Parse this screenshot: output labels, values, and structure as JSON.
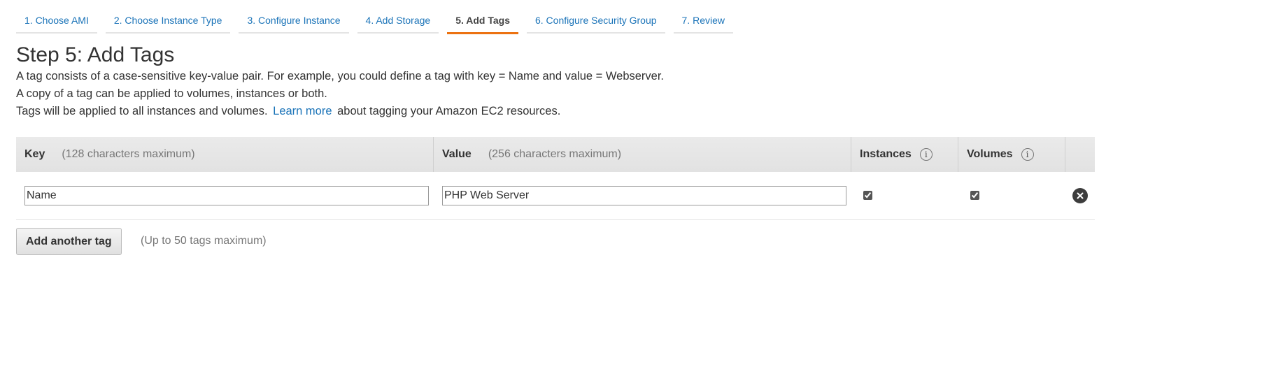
{
  "wizard": {
    "steps": [
      {
        "label": "1. Choose AMI"
      },
      {
        "label": "2. Choose Instance Type"
      },
      {
        "label": "3. Configure Instance"
      },
      {
        "label": "4. Add Storage"
      },
      {
        "label": "5. Add Tags"
      },
      {
        "label": "6. Configure Security Group"
      },
      {
        "label": "7. Review"
      }
    ],
    "active_step": "5. Add Tags"
  },
  "page": {
    "title": "Step 5: Add Tags",
    "description": {
      "line1": "A tag consists of a case-sensitive key-value pair. For example, you could define a tag with key = Name and value = Webserver.",
      "line2": "A copy of a tag can be applied to volumes, instances or both.",
      "line3_before": "Tags will be applied to all instances and volumes.",
      "learn_more": "Learn more",
      "line3_after": "about tagging your Amazon EC2 resources."
    }
  },
  "table": {
    "headers": {
      "key_label": "Key",
      "key_hint": "(128 characters maximum)",
      "value_label": "Value",
      "value_hint": "(256 characters maximum)",
      "instances_label": "Instances",
      "volumes_label": "Volumes",
      "info_glyph": "i"
    },
    "rows": [
      {
        "key": "Name",
        "value": "PHP Web Server",
        "instances": true,
        "volumes": true,
        "remove_icon": "close-circle-icon"
      }
    ]
  },
  "actions": {
    "add_tag_label": "Add another tag",
    "max_note": "(Up to 50 tags maximum)"
  },
  "colors": {
    "link": "#1a73b8",
    "active_tab_underline": "#ec7211",
    "header_bg": "#e6e6e6"
  }
}
